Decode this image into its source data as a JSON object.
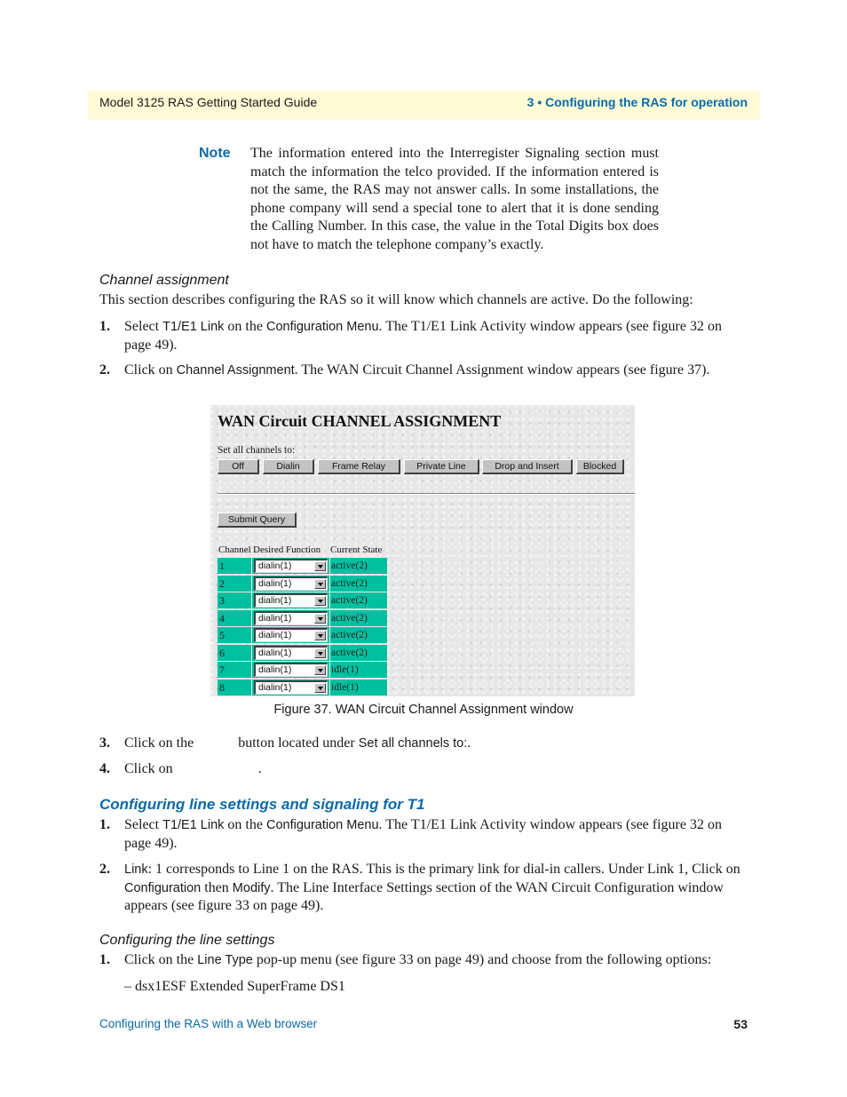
{
  "header": {
    "left": "Model 3125 RAS Getting Started Guide",
    "right": "3 • Configuring the RAS for operation"
  },
  "note": {
    "label": "Note",
    "text": "The information entered into the Interregister Signaling section must match the information the telco provided. If the information entered is not the same, the RAS may not answer calls. In some installations, the phone company will send a special tone to alert that it is done sending the Calling Number. In this case, the value in the Total Digits box does not have to match the telephone company’s exactly."
  },
  "channel_assignment": {
    "heading": "Channel assignment",
    "intro": "This section describes configuring the RAS so it will know which channels are active. Do the following:",
    "steps": [
      {
        "num": "1.",
        "parts": [
          "Select ",
          {
            "ui": "T1/E1 Link"
          },
          " on the ",
          {
            "ui": "Configuration Menu"
          },
          ". The T1/E1 Link Activity window appears (see figure 32 on page 49)."
        ]
      },
      {
        "num": "2.",
        "parts": [
          "Click on ",
          {
            "ui": "Channel Assignment"
          },
          ". The WAN Circuit Channel Assignment window appears (see figure 37)."
        ]
      }
    ]
  },
  "figure": {
    "title": "WAN Circuit CHANNEL ASSIGNMENT",
    "set_all_label": "Set all channels to:",
    "buttons": [
      "Off",
      "Dialin",
      "Frame Relay",
      "Private Line",
      "Drop and Insert",
      "Blocked"
    ],
    "submit_label": "Submit Query",
    "columns": [
      "Channel",
      "Desired Function",
      "Current State"
    ],
    "rows": [
      {
        "channel": "1",
        "function": "dialin(1)",
        "state": "active(2)"
      },
      {
        "channel": "2",
        "function": "dialin(1)",
        "state": "active(2)"
      },
      {
        "channel": "3",
        "function": "dialin(1)",
        "state": "active(2)"
      },
      {
        "channel": "4",
        "function": "dialin(1)",
        "state": "active(2)"
      },
      {
        "channel": "5",
        "function": "dialin(1)",
        "state": "active(2)"
      },
      {
        "channel": "6",
        "function": "dialin(1)",
        "state": "active(2)"
      },
      {
        "channel": "7",
        "function": "dialin(1)",
        "state": "idle(1)"
      },
      {
        "channel": "8",
        "function": "dialin(1)",
        "state": "idle(1)"
      }
    ],
    "caption": "Figure 37. WAN Circuit Channel Assignment window",
    "cell_color": "#00c0a0"
  },
  "steps_after": [
    {
      "num": "3.",
      "a": "Click on the",
      "b": "button located under ",
      "ui": "Set all channels to:",
      "c": "."
    },
    {
      "num": "4.",
      "a": "Click on",
      "b": "."
    }
  ],
  "line_settings": {
    "heading": "Configuring line settings and signaling for T1",
    "steps": [
      {
        "num": "1.",
        "parts": [
          "Select ",
          {
            "ui": "T1/E1 Link"
          },
          " on the ",
          {
            "ui": "Configuration Menu"
          },
          ". The T1/E1 Link Activity window appears (see figure 32 on page 49)."
        ]
      },
      {
        "num": "2.",
        "parts": [
          {
            "ui": "Link"
          },
          ": 1 corresponds to Line 1 on the RAS. This is the primary link for dial-in callers. Under Link 1, Click on ",
          {
            "ui": "Configuration"
          },
          " then ",
          {
            "ui": "Modify"
          },
          ". The Line Interface Settings section of the WAN Circuit Configuration window appears (see figure 33 on page 49)."
        ]
      }
    ],
    "sub_heading": "Configuring the line settings",
    "sub_steps": [
      {
        "num": "1.",
        "parts": [
          "Click on the ",
          {
            "ui": "Line Type"
          },
          " pop-up menu (see figure 33 on page 49) and choose from the following options:"
        ]
      }
    ],
    "option": "– dsx1ESF Extended SuperFrame DS1"
  },
  "footer": {
    "left": "Configuring the RAS with a Web browser",
    "page": "53"
  },
  "colors": {
    "accent_blue": "#0a6aa8",
    "header_band": "#fffbd6"
  }
}
